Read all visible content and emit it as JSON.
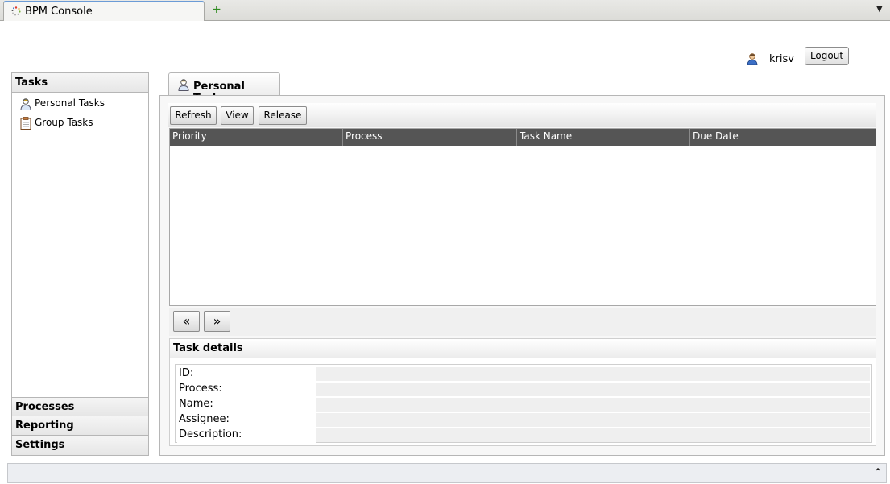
{
  "browser": {
    "tab_title": "BPM Console",
    "new_tab_glyph": "+",
    "tab_list_glyph": "▼"
  },
  "header": {
    "user_name": "krisv",
    "logout_label": "Logout"
  },
  "sidebar": {
    "sections": {
      "tasks": "Tasks",
      "processes": "Processes",
      "reporting": "Reporting",
      "settings": "Settings"
    },
    "items": [
      {
        "label": "Personal Tasks",
        "icon": "person-icon"
      },
      {
        "label": "Group Tasks",
        "icon": "clipboard-icon"
      }
    ]
  },
  "main": {
    "tab_label": "Personal Tasks",
    "toolbar": {
      "refresh": "Refresh",
      "view": "View",
      "release": "Release"
    },
    "grid": {
      "columns": [
        "Priority",
        "Process",
        "Task Name",
        "Due Date"
      ],
      "rows": []
    },
    "pager": {
      "prev": "«",
      "next": "»"
    },
    "details": {
      "title": "Task details",
      "fields": [
        {
          "label": "ID:",
          "value": ""
        },
        {
          "label": "Process:",
          "value": ""
        },
        {
          "label": "Name:",
          "value": ""
        },
        {
          "label": "Assignee:",
          "value": ""
        },
        {
          "label": "Description:",
          "value": ""
        }
      ]
    }
  },
  "footer": {
    "collapse_glyph": "⌃"
  },
  "colors": {
    "grid_header": "#555555",
    "active_tab_accent": "#6b9bd6"
  }
}
